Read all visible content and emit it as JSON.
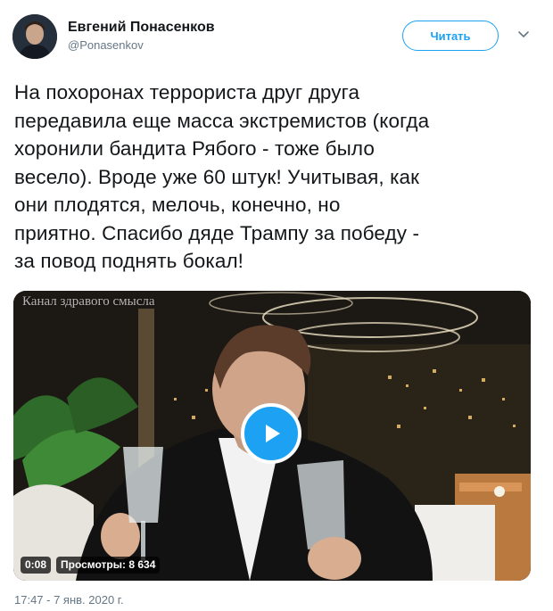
{
  "author": {
    "name": "Евгений Понасенков",
    "handle": "@Ponasenkov"
  },
  "actions": {
    "follow_label": "Читать"
  },
  "tweet": {
    "text": "На похоронах террориста друг друга\nпередавила еще масса экстремистов (когда\nхоронили бандита Рябого - тоже было\nвесело). Вроде уже 60 штук! Учитывая, как\nони плодятся, мелочь, конечно, но\nприятно. Спасибо дяде Трампу за победу -\nза повод поднять бокал!",
    "timestamp": "17:47 - 7 янв. 2020 г."
  },
  "media": {
    "watermark": "Канал здравого смысла",
    "duration": "0:08",
    "views": "Просмотры: 8 634"
  },
  "colors": {
    "accent": "#1da1f2",
    "text": "#14171a",
    "secondary": "#657786"
  },
  "icons": [
    "avatar",
    "chevron-down-icon",
    "play-icon"
  ]
}
